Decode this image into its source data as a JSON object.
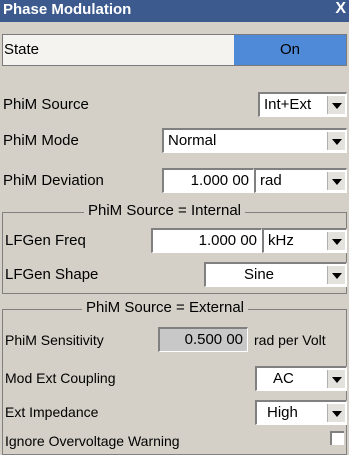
{
  "window": {
    "title": "Phase Modulation",
    "close": "X"
  },
  "state": {
    "label": "State",
    "value": "On"
  },
  "source": {
    "label": "PhiM Source",
    "value": "Int+Ext"
  },
  "mode": {
    "label": "PhiM Mode",
    "value": "Normal"
  },
  "deviation": {
    "label": "PhiM Deviation",
    "value": "1.000 00",
    "unit": "rad"
  },
  "internal": {
    "header": "PhiM Source = Internal",
    "lfgen_freq_label": "LFGen Freq",
    "lfgen_freq_value": "1.000 00",
    "lfgen_freq_unit": "kHz",
    "lfgen_shape_label": "LFGen Shape",
    "lfgen_shape_value": "Sine"
  },
  "external": {
    "header": "PhiM Source = External",
    "sensitivity_label": "PhiM Sensitivity",
    "sensitivity_value": "0.500 00",
    "sensitivity_unit": "rad per Volt",
    "coupling_label": "Mod Ext Coupling",
    "coupling_value": "AC",
    "impedance_label": "Ext Impedance",
    "impedance_value": "High",
    "overvoltage_label": "Ignore Overvoltage Warning"
  }
}
